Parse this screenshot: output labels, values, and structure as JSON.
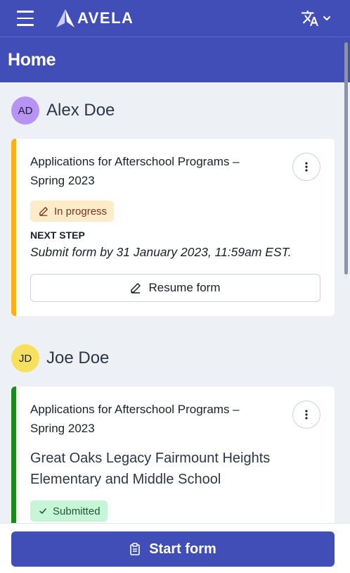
{
  "topbar": {
    "brand": "AVELA",
    "menu_icon": "hamburger-menu-icon",
    "language_icon": "translate-icon",
    "language_chevron": "chevron-down-icon"
  },
  "header": {
    "title": "Home"
  },
  "students": [
    {
      "initials": "AD",
      "name": "Alex Doe",
      "avatar_color": "#b794f4",
      "application": {
        "title": "Applications for Afterschool Programs – Spring 2023",
        "status": "In progress",
        "status_icon": "pencil-icon",
        "status_bg": "#feebc8",
        "status_color": "#7b341e",
        "accent_color": "#fbb017",
        "next_step_label": "NEXT STEP",
        "next_step_text": "Submit form by 31 January 2023, 11:59am EST.",
        "action_label": "Resume form",
        "action_icon": "pencil-icon"
      }
    },
    {
      "initials": "JD",
      "name": "Joe Doe",
      "avatar_color": "#f6e05e",
      "application": {
        "title": "Applications for Afterschool Programs – Spring 2023",
        "school": "Great Oaks Legacy Fairmount Heights Elementary and Middle School",
        "status": "Submitted",
        "status_icon": "check-icon",
        "status_bg": "#c6f6d5",
        "status_color": "#22543d",
        "accent_color": "#1b8a1b"
      }
    }
  ],
  "footer": {
    "start_label": "Start form",
    "start_icon": "clipboard-icon"
  }
}
